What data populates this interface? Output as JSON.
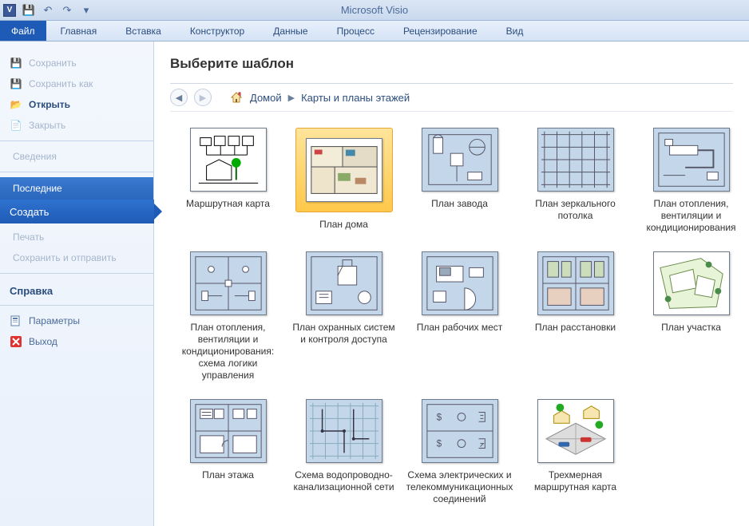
{
  "app_title": "Microsoft Visio",
  "visio_icon_letter": "V",
  "ribbon_tabs": {
    "file": "Файл",
    "home": "Главная",
    "insert": "Вставка",
    "designer": "Конструктор",
    "data": "Данные",
    "process": "Процесс",
    "review": "Рецензирование",
    "view": "Вид"
  },
  "sidebar": {
    "save": "Сохранить",
    "save_as": "Сохранить как",
    "open": "Открыть",
    "close": "Закрыть",
    "info": "Сведения",
    "recent": "Последние",
    "create": "Создать",
    "print": "Печать",
    "save_send": "Сохранить и отправить",
    "help": "Справка",
    "options": "Параметры",
    "exit": "Выход"
  },
  "content": {
    "heading": "Выберите шаблон",
    "breadcrumb_home": "Домой",
    "breadcrumb_category": "Карты и планы этажей"
  },
  "templates": [
    {
      "id": "route-map",
      "label": "Маршрутная карта",
      "thumb": "buildings",
      "bg": "white"
    },
    {
      "id": "house-plan",
      "label": "План дома",
      "thumb": "floor-color",
      "bg": "white",
      "selected": true
    },
    {
      "id": "factory-plan",
      "label": "План завода",
      "thumb": "factory",
      "bg": "blue"
    },
    {
      "id": "ceiling-plan",
      "label": "План зеркального потолка",
      "thumb": "grid",
      "bg": "blue"
    },
    {
      "id": "hvac-plan",
      "label": "План отопления, вентиляции и кондиционирования",
      "thumb": "hvac",
      "bg": "blue"
    },
    {
      "id": "hvac-logic",
      "label": "План отопления, вентиляции и кондиционирования: схема логики управления",
      "thumb": "hvac-logic",
      "bg": "blue"
    },
    {
      "id": "security-plan",
      "label": "План охранных систем и контроля доступа",
      "thumb": "security",
      "bg": "blue"
    },
    {
      "id": "workspace-plan",
      "label": "План рабочих мест",
      "thumb": "workspace",
      "bg": "blue"
    },
    {
      "id": "layout-plan",
      "label": "План расстановки",
      "thumb": "layout",
      "bg": "blue"
    },
    {
      "id": "site-plan",
      "label": "План участка",
      "thumb": "site",
      "bg": "white"
    },
    {
      "id": "floor-plan",
      "label": "План этажа",
      "thumb": "floor-bw",
      "bg": "blue"
    },
    {
      "id": "plumbing",
      "label": "Схема водопроводно-канализационной сети",
      "thumb": "plumbing",
      "bg": "blue"
    },
    {
      "id": "electrical",
      "label": "Схема электрических и телекоммуникационных соединений",
      "thumb": "electrical",
      "bg": "blue"
    },
    {
      "id": "3d-route",
      "label": "Трехмерная маршрутная карта",
      "thumb": "3d-route",
      "bg": "white"
    }
  ]
}
